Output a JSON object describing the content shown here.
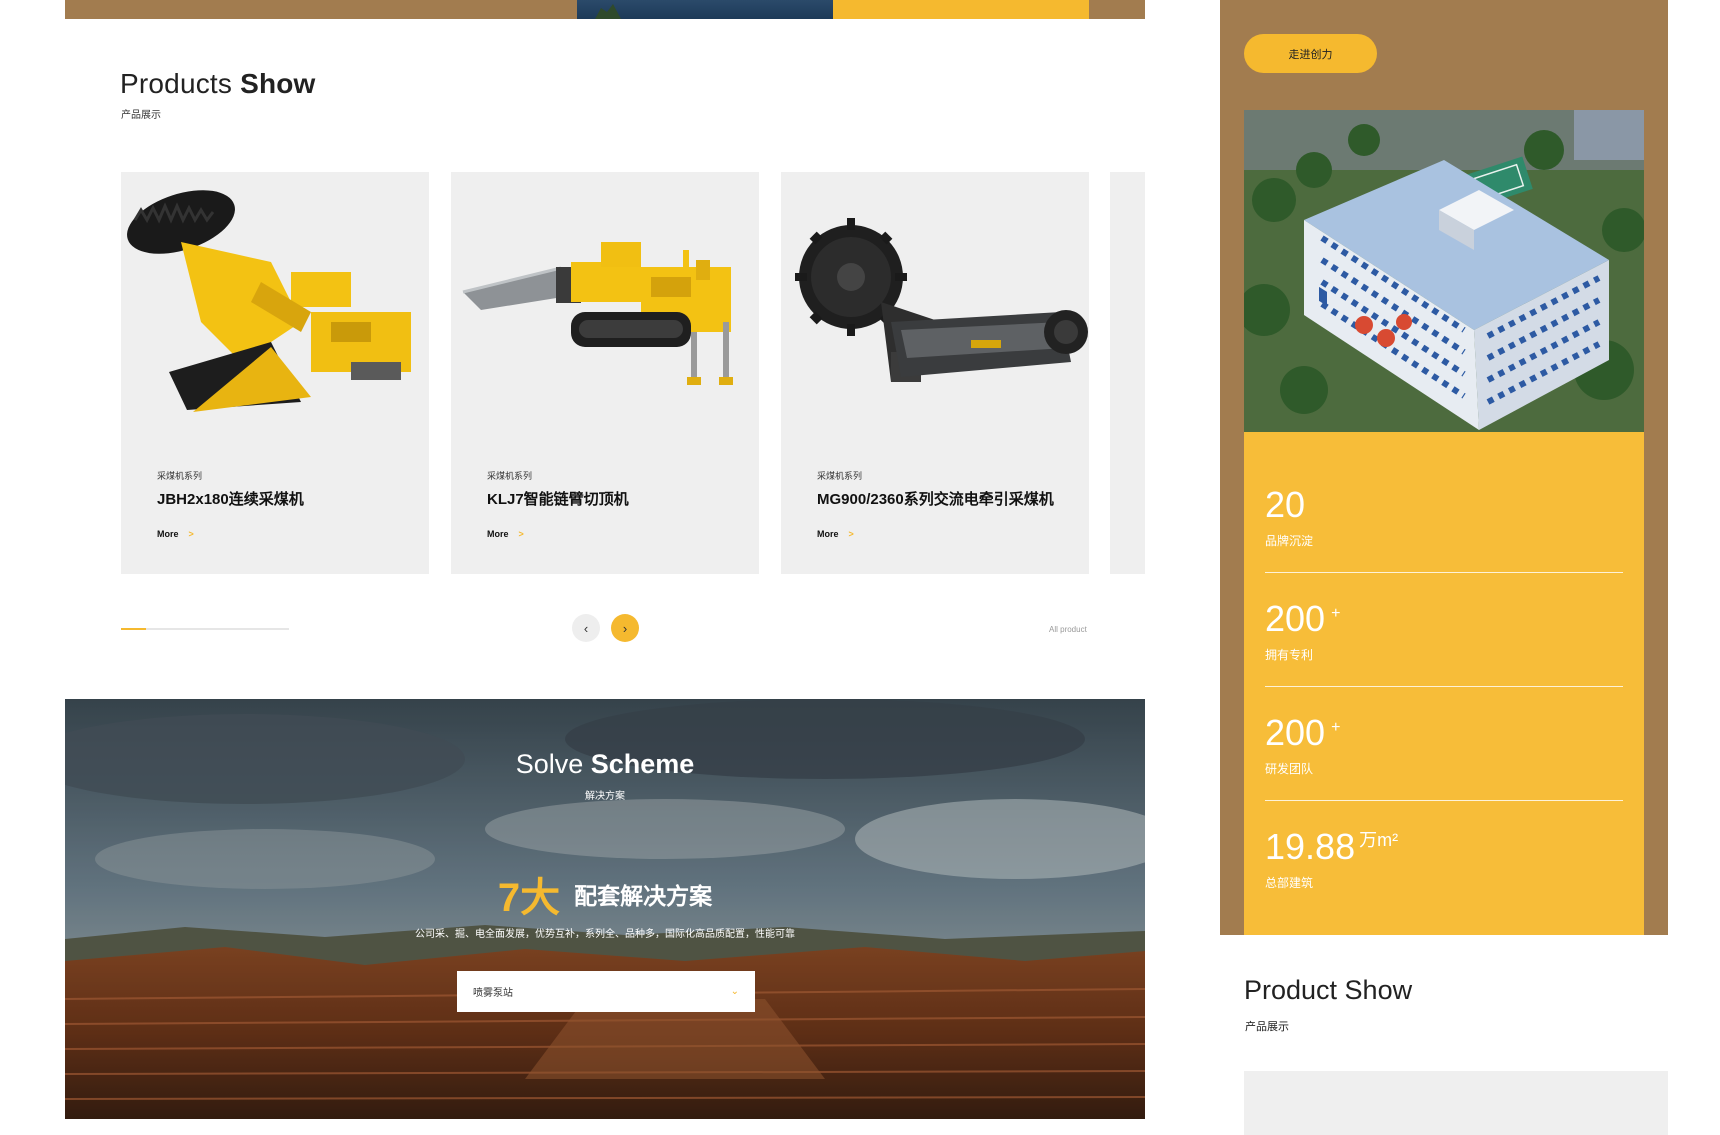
{
  "products_section": {
    "title_light": "Products ",
    "title_bold": "Show",
    "subtitle": "产品展示",
    "cards": [
      {
        "category": "采煤机系列",
        "name": "JBH2x180连续采煤机",
        "more": "More",
        "arrow": ">",
        "image_icon": "continuous-miner-image"
      },
      {
        "category": "采煤机系列",
        "name": "KLJ7智能链臂切顶机",
        "more": "More",
        "arrow": ">",
        "image_icon": "chain-arm-roof-cutter-image"
      },
      {
        "category": "采煤机系列",
        "name": "MG900/2360系列交流电牵引采煤机",
        "more": "More",
        "arrow": ">",
        "image_icon": "shearer-image"
      }
    ],
    "slider_progress_fraction": 0.15,
    "prev_icon": "‹",
    "next_icon": "›",
    "all_product": "All product"
  },
  "solve_section": {
    "title_light": "Solve ",
    "title_bold": "Scheme",
    "subtitle": "解决方案",
    "heading_number": "7大",
    "heading_text": "配套解决方案",
    "description": "公司采、掘、电全面发展，优势互补，系列全、品种多，国际化高品质配置，性能可靠",
    "select_value": "喷雾泵站",
    "select_icon": "⌄"
  },
  "about_panel": {
    "button_label": "走进创力",
    "stats": [
      {
        "value": "20",
        "suffix": "",
        "unit": "",
        "label": "品牌沉淀"
      },
      {
        "value": "200",
        "suffix": "+",
        "unit": "",
        "label": "拥有专利"
      },
      {
        "value": "200",
        "suffix": "+",
        "unit": "",
        "label": "研发团队"
      },
      {
        "value": "19.88",
        "suffix": "",
        "unit": "万m²",
        "label": "总部建筑"
      }
    ]
  },
  "product_show_mobile": {
    "title": "Product Show",
    "subtitle": "产品展示"
  },
  "colors": {
    "accent_yellow": "#f5b92f",
    "brown_panel": "#a27c4f",
    "card_gray": "#efefef"
  }
}
